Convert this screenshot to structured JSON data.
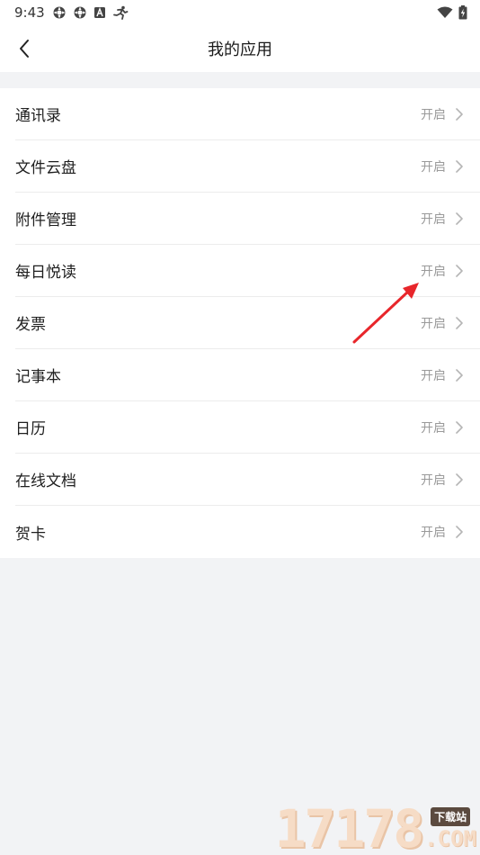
{
  "status_bar": {
    "time": "9:43",
    "icons": [
      "gear-icon",
      "gear-icon",
      "a-badge-icon",
      "running-icon"
    ],
    "right_icons": [
      "wifi-icon",
      "battery-charging-icon"
    ]
  },
  "nav": {
    "title": "我的应用",
    "back_icon": "chevron-left-icon"
  },
  "apps": [
    {
      "label": "通讯录",
      "status": "开启"
    },
    {
      "label": "文件云盘",
      "status": "开启"
    },
    {
      "label": "附件管理",
      "status": "开启"
    },
    {
      "label": "每日悦读",
      "status": "开启"
    },
    {
      "label": "发票",
      "status": "开启"
    },
    {
      "label": "记事本",
      "status": "开启"
    },
    {
      "label": "日历",
      "status": "开启"
    },
    {
      "label": "在线文档",
      "status": "开启"
    },
    {
      "label": "贺卡",
      "status": "开启"
    }
  ],
  "watermark": {
    "digits": "17178",
    "tag": "下载站",
    "com": ".COM"
  },
  "colors": {
    "background": "#f2f3f5",
    "status_text": "#9a9a9a",
    "annotation_arrow": "#e8262b"
  }
}
